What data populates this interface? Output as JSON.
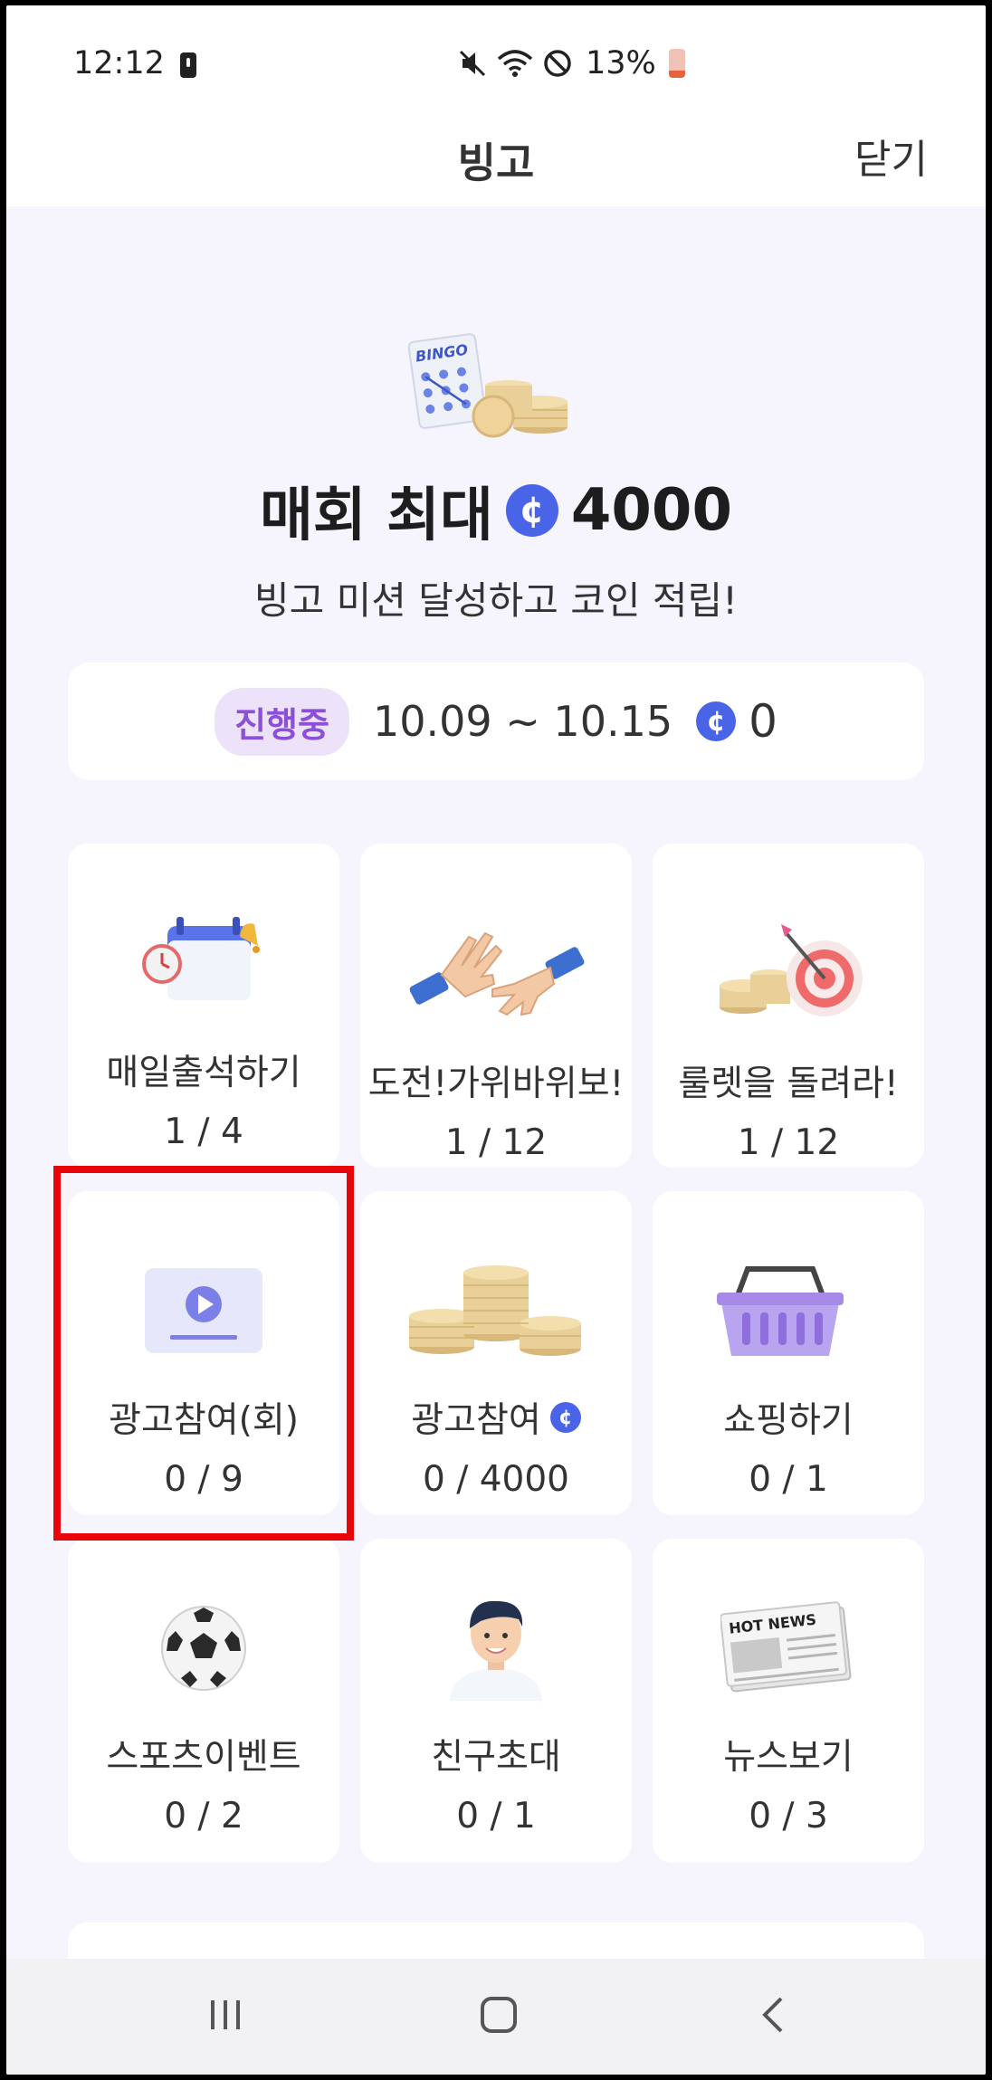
{
  "status_bar": {
    "time": "12:12",
    "battery_percent": "13%"
  },
  "header": {
    "title": "빙고",
    "close_label": "닫기"
  },
  "hero": {
    "illustration_label": "BINGO",
    "title_prefix": "매회 최대",
    "title_amount": "4000",
    "subtitle": "빙고 미션 달성하고 코인 적립!",
    "coin_symbol": "¢"
  },
  "period": {
    "status_badge": "진행중",
    "date_range": "10.09 ~ 10.15",
    "coin_total": "0"
  },
  "missions": [
    {
      "label": "매일출석하기",
      "progress": "1 / 4",
      "icon": "calendar-alarm-icon"
    },
    {
      "label": "도전!가위바위보!",
      "progress": "1 / 12",
      "icon": "rock-paper-scissors-hands-icon"
    },
    {
      "label": "룰렛을 돌려라!",
      "progress": "1 / 12",
      "icon": "target-coins-icon"
    },
    {
      "label": "광고참여(회)",
      "progress": "0 / 9",
      "icon": "video-play-icon"
    },
    {
      "label": "광고참여",
      "progress": "0 / 4000",
      "icon": "coin-stacks-icon",
      "has_coin": true
    },
    {
      "label": "쇼핑하기",
      "progress": "0 / 1",
      "icon": "shopping-basket-icon"
    },
    {
      "label": "스포츠이벤트",
      "progress": "0 / 2",
      "icon": "soccer-ball-icon"
    },
    {
      "label": "친구초대",
      "progress": "0 / 1",
      "icon": "friend-avatar-icon"
    },
    {
      "label": "뉴스보기",
      "progress": "0 / 3",
      "icon": "newspaper-icon"
    }
  ],
  "news_icon_text": "HOT NEWS",
  "colors": {
    "accent_coin": "#4a64e8",
    "badge_text": "#8b4fd8",
    "badge_bg": "#ece3fb",
    "highlight": "#e8060a",
    "background": "#f6f4fd"
  }
}
